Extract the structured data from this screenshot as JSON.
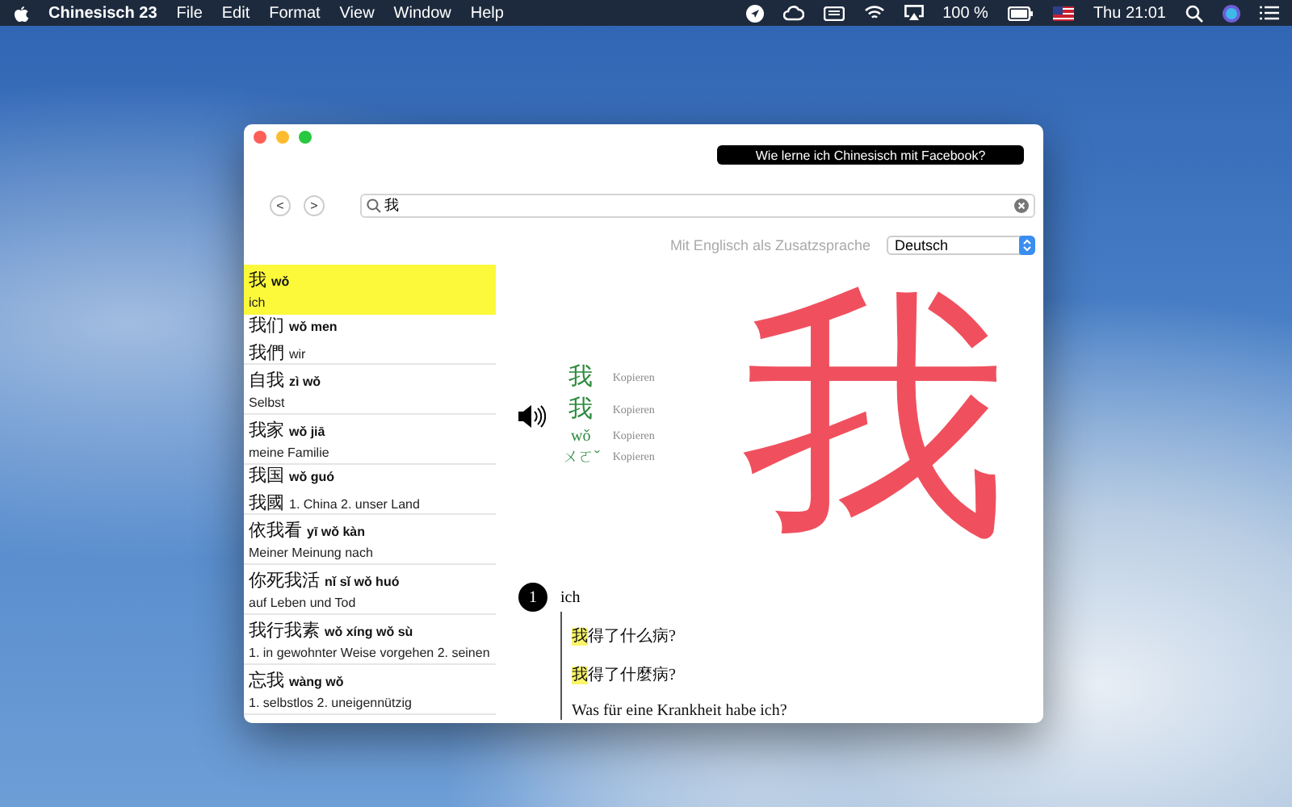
{
  "menubar": {
    "app": "Chinesisch 23",
    "menus": [
      "File",
      "Edit",
      "Format",
      "View",
      "Window",
      "Help"
    ],
    "battery": "100 %",
    "clock": "Thu 21:01"
  },
  "window": {
    "promo_button": "Wie lerne ich Chinesisch mit Facebook?",
    "nav_buttons": [
      "<",
      ">"
    ],
    "search": {
      "value": "我"
    },
    "language": {
      "label": "Mit Englisch als Zusatzsprache",
      "value": "Deutsch"
    },
    "results": [
      {
        "hanzi": "我",
        "pinyin": "wǒ",
        "gloss": "ich",
        "selected": true
      },
      {
        "hanzi": "我们",
        "pinyin": "wǒ men",
        "traditional": "我們",
        "gloss": "wir",
        "selected": false
      },
      {
        "hanzi": "自我",
        "pinyin": "zì wǒ",
        "gloss": "Selbst",
        "selected": false
      },
      {
        "hanzi": "我家",
        "pinyin": "wǒ jiā",
        "gloss": "meine Familie",
        "selected": false
      },
      {
        "hanzi": "我国",
        "pinyin": "wǒ guó",
        "traditional": "我國",
        "gloss": "1. China 2. unser Land",
        "selected": false
      },
      {
        "hanzi": "依我看",
        "pinyin": "yī wǒ kàn",
        "gloss": "Meiner Meinung nach",
        "selected": false
      },
      {
        "hanzi": "你死我活",
        "pinyin": "nǐ sǐ wǒ huó",
        "gloss": "auf Leben und Tod",
        "selected": false
      },
      {
        "hanzi": "我行我素",
        "pinyin": "wǒ xíng wǒ sù",
        "gloss": "1. in gewohnter Weise vorgehen 2. seinen",
        "selected": false
      },
      {
        "hanzi": "忘我",
        "pinyin": "wàng wǒ",
        "gloss": "1. selbstlos 2. uneigennützig",
        "selected": false
      }
    ],
    "detail": {
      "forms": [
        {
          "kind": "hanzi",
          "text": "我",
          "copy": "Kopieren"
        },
        {
          "kind": "hanzi",
          "text": "我",
          "copy": "Kopieren"
        },
        {
          "kind": "pinyin",
          "text": "wǒ",
          "copy": "Kopieren"
        },
        {
          "kind": "zhuyin",
          "text": "ㄨㄛˇ",
          "copy": "Kopieren"
        }
      ],
      "big_character": "我",
      "senses": [
        {
          "number": "1",
          "meaning": "ich",
          "examples": [
            {
              "kind": "hanzi",
              "highlight": "我",
              "rest": "得了什么病?"
            },
            {
              "kind": "hanzi",
              "highlight": "我",
              "rest": "得了什麼病?"
            },
            {
              "kind": "translation",
              "rest": "Was für eine Krankheit habe ich?"
            }
          ]
        }
      ]
    }
  }
}
